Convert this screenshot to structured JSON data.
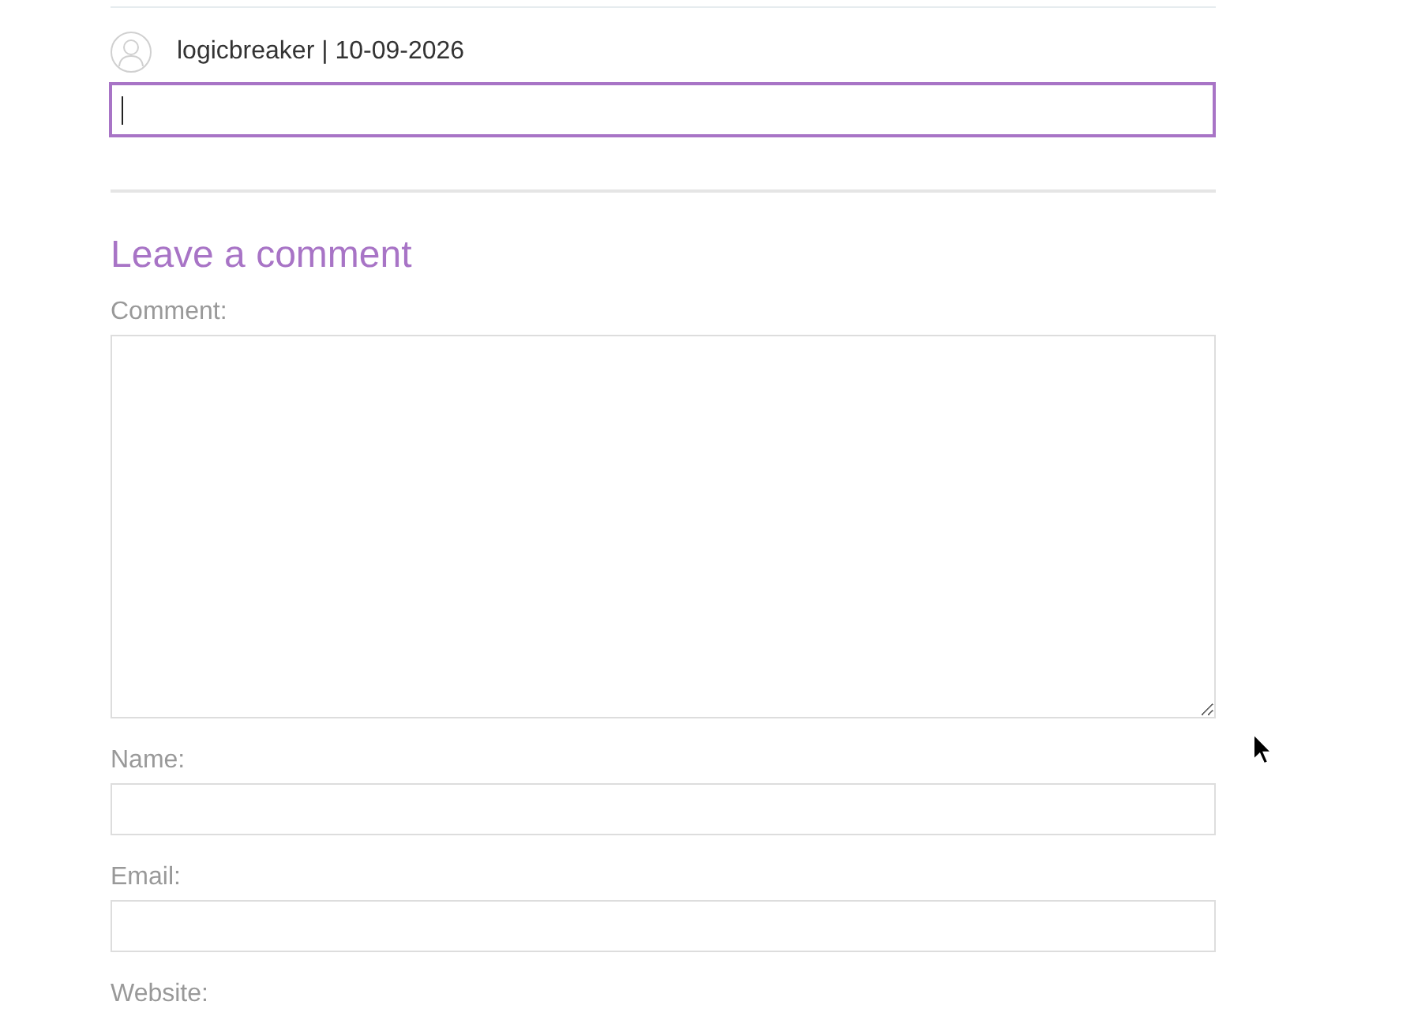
{
  "reply": {
    "meta": "logicbreaker | 10-09-2026",
    "focused": true
  },
  "form": {
    "title": "Leave a comment",
    "fields": [
      {
        "kind": "textarea",
        "label": "Comment:"
      },
      {
        "kind": "text",
        "label": "Name:"
      },
      {
        "kind": "text",
        "label": "Email:"
      },
      {
        "kind": "label",
        "label": "Website:"
      }
    ]
  }
}
